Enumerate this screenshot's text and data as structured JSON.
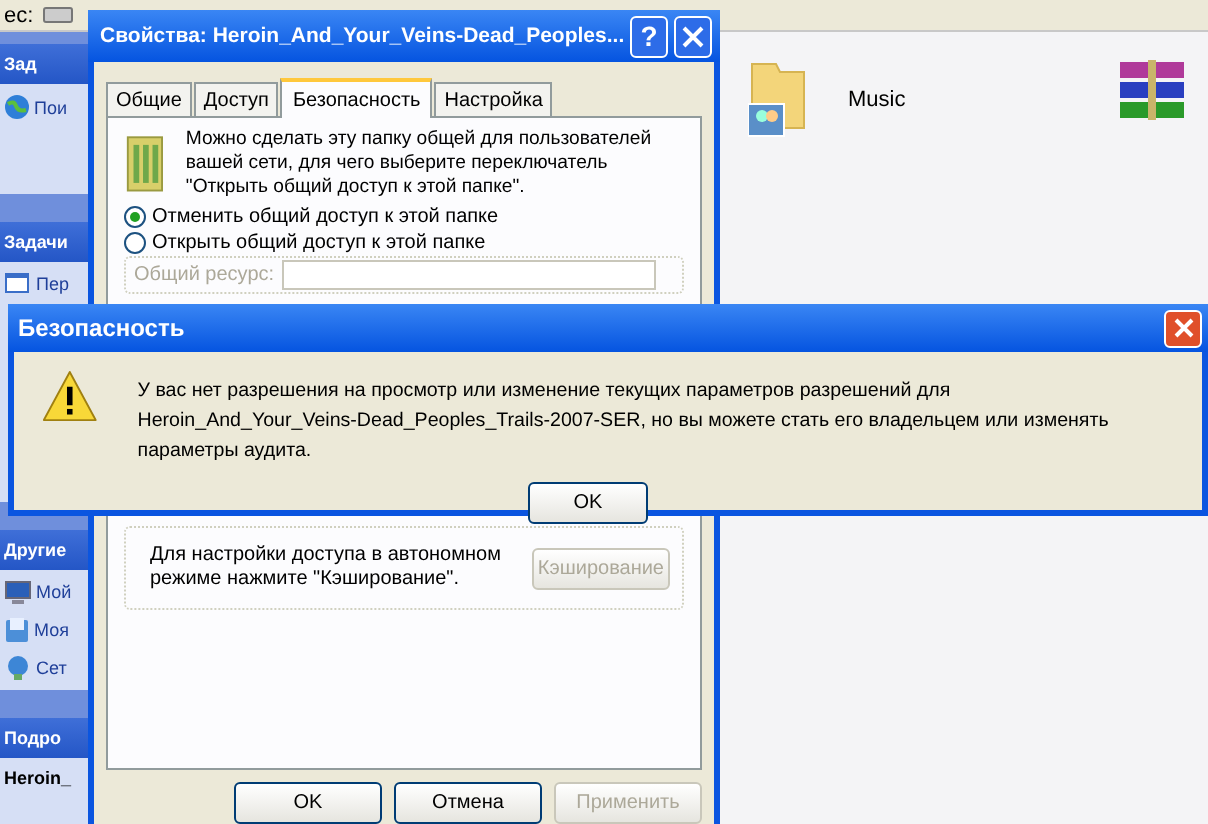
{
  "explorer": {
    "address_label": "ес:",
    "sidebar": [
      {
        "title": "Зад",
        "items": [
          {
            "label": "Пои",
            "kind": "link"
          }
        ]
      },
      {
        "title": "Задачи",
        "items": [
          {
            "label": "Пер",
            "kind": "link"
          }
        ]
      },
      {
        "title": "Другие",
        "items": [
          {
            "label": "Мой",
            "kind": "link"
          },
          {
            "label": "Моя",
            "kind": "link"
          },
          {
            "label": "Сет",
            "kind": "link"
          }
        ]
      },
      {
        "title": "Подро",
        "items": [
          {
            "label": "Heroin_",
            "kind": "name"
          }
        ]
      }
    ],
    "files": [
      {
        "kind": "shared-folder",
        "label": "Music"
      },
      {
        "kind": "archive"
      }
    ]
  },
  "properties": {
    "title": "Свойства: Heroin_And_Your_Veins-Dead_Peoples...",
    "help": "?",
    "tabs": [
      {
        "label": "Общие",
        "selected": false
      },
      {
        "label": "Доступ",
        "selected": false
      },
      {
        "label": "Безопасность",
        "selected": true
      },
      {
        "label": "Настройка",
        "selected": false
      }
    ],
    "intro": "Можно сделать эту папку общей для пользователей вашей сети, для чего выберите переключатель \"Открыть общий доступ к этой папке\".",
    "radios": [
      {
        "label": "Отменить общий доступ к этой папке",
        "selected": true
      },
      {
        "label": "Открыть общий доступ к этой папке",
        "selected": false
      }
    ],
    "share_label": {
      "label": "Общий ресурс:",
      "disabled": true
    },
    "offline_text": "Для настройки доступа в автономном режиме нажмите \"Кэширование\".",
    "caching_button": {
      "label": "Кэширование",
      "disabled": true
    },
    "buttons": [
      {
        "label": "OK",
        "disabled": false
      },
      {
        "label": "Отмена",
        "disabled": false
      },
      {
        "label": "Применить",
        "disabled": true
      }
    ]
  },
  "alert": {
    "title": "Безопасность",
    "message": "У вас нет разрешения на просмотр или изменение текущих параметров разрешений для\nHeroin_And_Your_Veins-Dead_Peoples_Trails-2007-SER, но вы можете стать его владельцем или изменять параметры аудита.",
    "button": "OK"
  }
}
